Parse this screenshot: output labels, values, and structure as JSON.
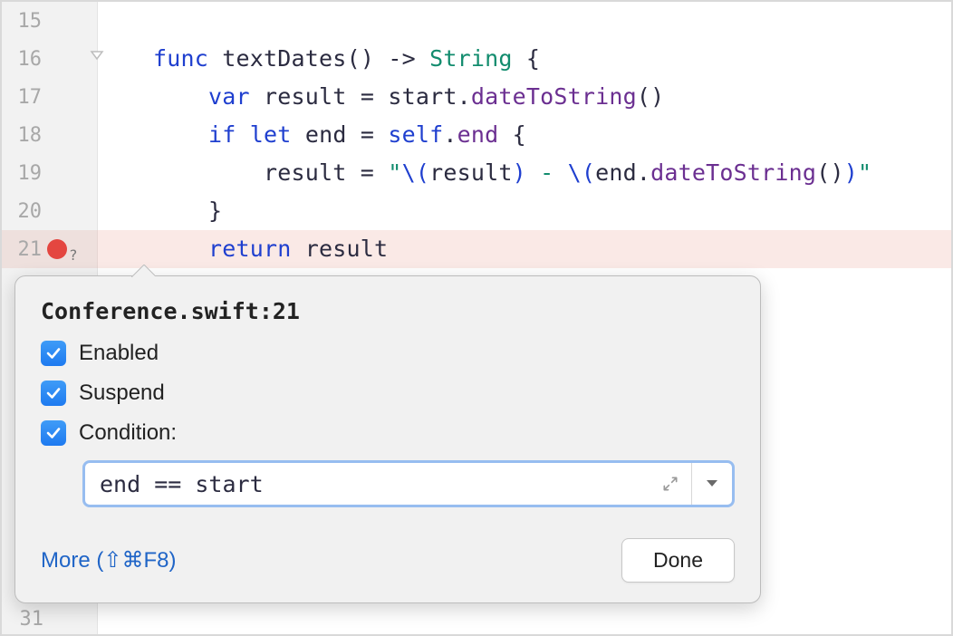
{
  "editor": {
    "lines": [
      {
        "n": 15,
        "tokens": []
      },
      {
        "n": 16,
        "fold": true,
        "tokens": [
          {
            "cls": "punct",
            "t": "    "
          },
          {
            "cls": "kw",
            "t": "func"
          },
          {
            "cls": "punct",
            "t": " "
          },
          {
            "cls": "ident",
            "t": "textDates"
          },
          {
            "cls": "punct",
            "t": "() -> "
          },
          {
            "cls": "type",
            "t": "String"
          },
          {
            "cls": "punct",
            "t": " {"
          }
        ]
      },
      {
        "n": 17,
        "tokens": [
          {
            "cls": "punct",
            "t": "        "
          },
          {
            "cls": "kw",
            "t": "var"
          },
          {
            "cls": "punct",
            "t": " "
          },
          {
            "cls": "ident",
            "t": "result"
          },
          {
            "cls": "punct",
            "t": " = "
          },
          {
            "cls": "ident",
            "t": "start"
          },
          {
            "cls": "punct",
            "t": "."
          },
          {
            "cls": "prop",
            "t": "dateToString"
          },
          {
            "cls": "punct",
            "t": "()"
          }
        ]
      },
      {
        "n": 18,
        "tokens": [
          {
            "cls": "punct",
            "t": "        "
          },
          {
            "cls": "kw",
            "t": "if"
          },
          {
            "cls": "punct",
            "t": " "
          },
          {
            "cls": "kw",
            "t": "let"
          },
          {
            "cls": "punct",
            "t": " "
          },
          {
            "cls": "ident",
            "t": "end"
          },
          {
            "cls": "punct",
            "t": " = "
          },
          {
            "cls": "kw",
            "t": "self"
          },
          {
            "cls": "punct",
            "t": "."
          },
          {
            "cls": "prop",
            "t": "end"
          },
          {
            "cls": "punct",
            "t": " {"
          }
        ]
      },
      {
        "n": 19,
        "tokens": [
          {
            "cls": "punct",
            "t": "            "
          },
          {
            "cls": "ident",
            "t": "result"
          },
          {
            "cls": "punct",
            "t": " = "
          },
          {
            "cls": "str",
            "t": "\""
          },
          {
            "cls": "esc",
            "t": "\\("
          },
          {
            "cls": "ident",
            "t": "result"
          },
          {
            "cls": "esc",
            "t": ")"
          },
          {
            "cls": "str",
            "t": " - "
          },
          {
            "cls": "esc",
            "t": "\\("
          },
          {
            "cls": "ident",
            "t": "end"
          },
          {
            "cls": "punct",
            "t": "."
          },
          {
            "cls": "prop",
            "t": "dateToString"
          },
          {
            "cls": "punct",
            "t": "()"
          },
          {
            "cls": "esc",
            "t": ")"
          },
          {
            "cls": "str",
            "t": "\""
          }
        ]
      },
      {
        "n": 20,
        "tokens": [
          {
            "cls": "punct",
            "t": "        }"
          }
        ]
      },
      {
        "n": 21,
        "breakpoint": true,
        "tokens": [
          {
            "cls": "punct",
            "t": "        "
          },
          {
            "cls": "kw",
            "t": "return"
          },
          {
            "cls": "punct",
            "t": " "
          },
          {
            "cls": "ident",
            "t": "result"
          }
        ]
      }
    ],
    "bottom_line_number": 31
  },
  "popover": {
    "title": "Conference.swift:21",
    "enabled_label": "Enabled",
    "suspend_label": "Suspend",
    "condition_label": "Condition:",
    "condition_value": "end == start",
    "more_label": "More (⇧⌘F8)",
    "done_label": "Done"
  }
}
